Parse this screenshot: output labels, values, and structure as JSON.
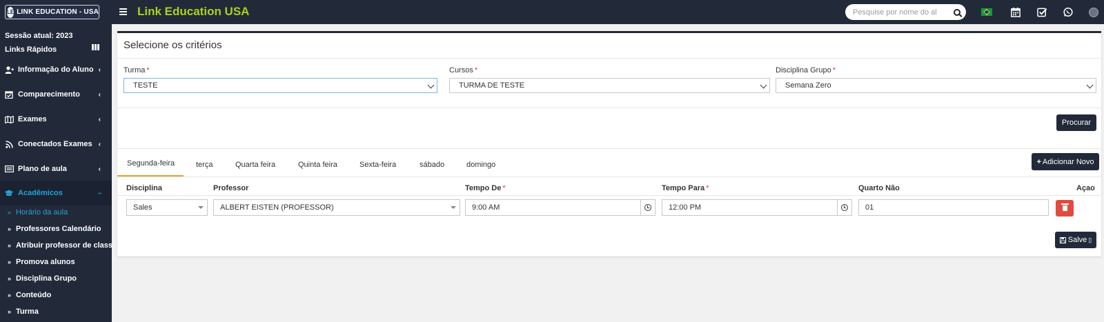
{
  "header": {
    "logo_text": "LINK EDUCATION - USA",
    "app_title": "Link Education USA",
    "search_placeholder": "Pesquise por nome do al"
  },
  "sidebar": {
    "session": "Sessão atual: 2023",
    "quick_links": "Links Rápidos",
    "items": [
      {
        "label": "Informação do Aluno",
        "icon": "user-plus-icon"
      },
      {
        "label": "Comparecimento",
        "icon": "calendar-check-icon"
      },
      {
        "label": "Exames",
        "icon": "map-icon"
      },
      {
        "label": "Conectados Exames",
        "icon": "rss-icon"
      },
      {
        "label": "Plano de aula",
        "icon": "id-card-icon"
      },
      {
        "label": "Acadêmicos",
        "icon": "graduation-cap-icon",
        "active": true
      }
    ],
    "subitems": [
      {
        "label": "Horário da aula",
        "active": true
      },
      {
        "label": "Professores Calendário"
      },
      {
        "label": "Atribuir professor de classe"
      },
      {
        "label": "Promova alunos"
      },
      {
        "label": "Disciplina Grupo"
      },
      {
        "label": "Conteúdo"
      },
      {
        "label": "Turma"
      }
    ]
  },
  "panel": {
    "title": "Selecione os critérios",
    "fields": {
      "turma": {
        "label": "Turma",
        "value": "TESTE"
      },
      "cursos": {
        "label": "Cursos",
        "value": "TURMA DE TESTE"
      },
      "disciplina_grupo": {
        "label": "Disciplina Grupo",
        "value": "Semana Zero"
      }
    },
    "search_button": "Procurar",
    "tabs": [
      "Segunda-feira",
      "terça",
      "Quarta feira",
      "Quinta feira",
      "Sexta-feira",
      "sábado",
      "domingo"
    ],
    "active_tab": "Segunda-feira",
    "add_button": "Adicionar Novo",
    "columns": {
      "disciplina": "Disciplina",
      "professor": "Professor",
      "tempo_de": "Tempo De",
      "tempo_para": "Tempo Para",
      "quarto": "Quarto Não",
      "acao": "Açao"
    },
    "row": {
      "disciplina": "Sales",
      "professor": "ALBERT EISTEN (PROFESSOR)",
      "tempo_de": "9:00 AM",
      "tempo_para": "12:00 PM",
      "quarto": "01"
    },
    "save_button": "Salve"
  },
  "colors": {
    "navy": "#222a3a",
    "accent_green": "#a8d41d",
    "active_blue": "#27a2d3",
    "tab_underline": "#f0a020",
    "delete_red": "#e04b3f"
  }
}
